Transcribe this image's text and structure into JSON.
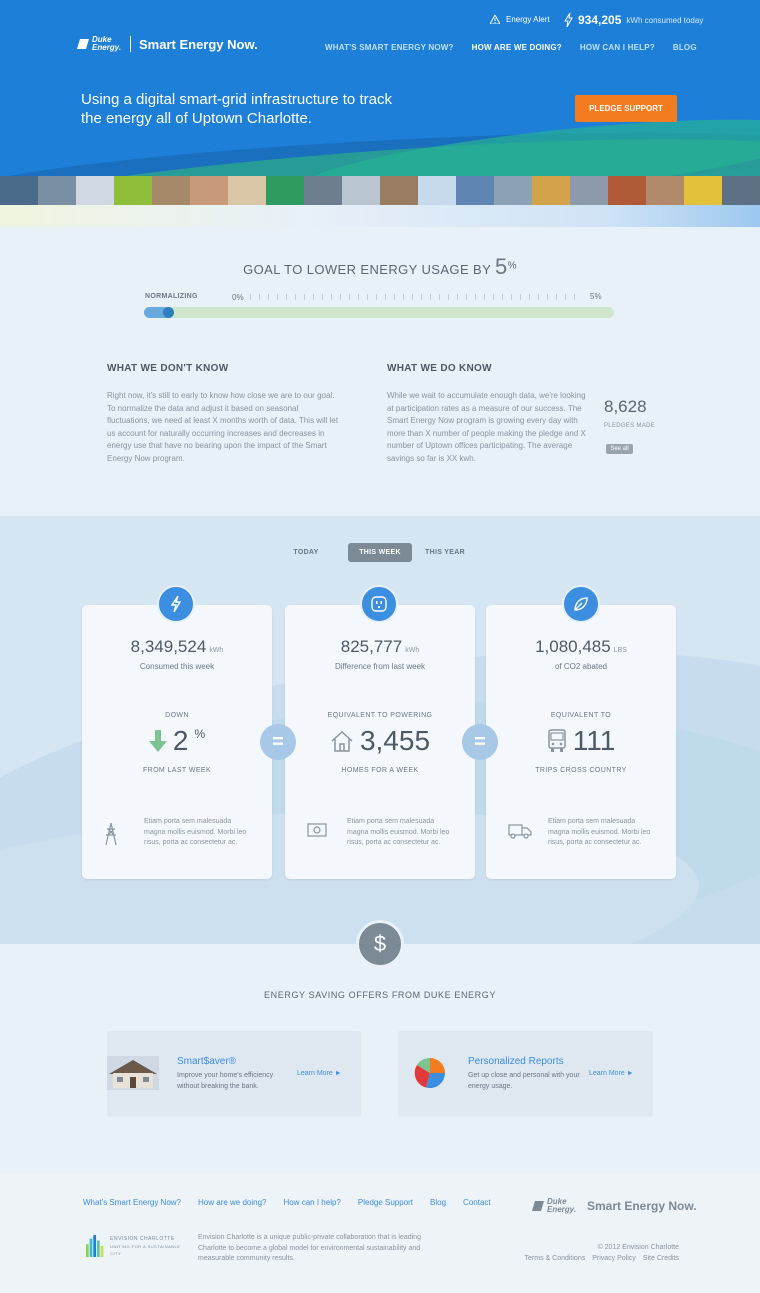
{
  "header": {
    "alert_label": "Energy Alert",
    "consumed_value": "934,205",
    "consumed_label": "kWh consumed today",
    "logo_duke": "Duke Energy.",
    "logo_product": "Smart Energy Now.",
    "nav": [
      {
        "label": "WHAT'S SMART ENERGY NOW?"
      },
      {
        "label": "HOW ARE WE DOING?",
        "active": true
      },
      {
        "label": "HOW CAN I HELP?"
      },
      {
        "label": "BLOG"
      }
    ],
    "tagline": "Using a digital smart-grid infrastructure to track the energy all of Uptown Charlotte.",
    "pledge_button": "PLEDGE SUPPORT",
    "brand_color": "#1d7fd8",
    "accent_color": "#f47b20"
  },
  "goal": {
    "title": "GOAL TO LOWER ENERGY USAGE BY",
    "value": "5",
    "unit": "%",
    "normalizing_label": "NORMALIZING",
    "start_label": "0%",
    "end_label": "5%",
    "progress_fraction": 0.06
  },
  "dont_know": {
    "heading": "WHAT WE DON'T KNOW",
    "body": "Right now, it's still to early to know how close we are to our goal. To normalize the data and adjust it based on seasonal fluctuations, we need at least X months worth of data. This will let us account for naturally occurring increases and decreases in energy use that have no bearing upon the impact of the Smart Energy Now program."
  },
  "do_know": {
    "heading": "WHAT WE DO KNOW",
    "body": "While we wait to accumulate enough data, we're looking at participation rates as a measure of our success. The Smart Energy Now program is growing every day with more than X number of people making the pledge and X number of Uptown offices participating. The average savings so far is XX kwh.",
    "pledges_value": "8,628",
    "pledges_label": "PLEDGES MADE",
    "see_all": "See all"
  },
  "tabs": [
    {
      "label": "TODAY"
    },
    {
      "label": "THIS WEEK",
      "active": true
    },
    {
      "label": "THIS YEAR"
    }
  ],
  "cards": [
    {
      "icon": "lightning-icon",
      "value": "8,349,524",
      "unit": "kWh",
      "label": "Consumed this week",
      "eq_top": "DOWN",
      "eq_value": "2",
      "eq_unit": "%",
      "eq_bottom": "FROM LAST WEEK",
      "foot_icon": "power-tower-icon",
      "foot_text": "Etiam porta sem malesuada magna mollis euismod. Morbi leo risus, porta ac consectetur ac."
    },
    {
      "icon": "outlet-icon",
      "value": "825,777",
      "unit": "kWh",
      "label": "Difference from last week",
      "eq_top": "EQUIVALENT TO POWERING",
      "eq_value": "3,455",
      "eq_unit": "",
      "eq_bottom": "HOMES FOR A WEEK",
      "foot_icon": "money-bill-icon",
      "foot_text": "Etiam porta sem malesuada magna mollis euismod. Morbi leo risus, porta ac consectetur ac."
    },
    {
      "icon": "leaf-icon",
      "value": "1,080,485",
      "unit": "LBS",
      "label": "of CO2 abated",
      "eq_top": "EQUIVALENT TO",
      "eq_value": "111",
      "eq_unit": "",
      "eq_bottom": "TRIPS CROSS COUNTRY",
      "foot_icon": "truck-icon",
      "foot_text": "Etiam porta sem malesuada magna mollis euismod. Morbi leo risus, porta ac consectetur ac."
    }
  ],
  "offers": {
    "title": "ENERGY SAVING OFFERS FROM DUKE ENERGY",
    "items": [
      {
        "title": "Smart$aver®",
        "desc": "Improve your home's efficiency without breaking the bank.",
        "link": "Learn More ►"
      },
      {
        "title": "Personalized Reports",
        "desc": "Get up close and personal with your energy usage.",
        "link": "Learn More ►"
      }
    ]
  },
  "footer": {
    "links": [
      {
        "label": "What's Smart Energy Now?"
      },
      {
        "label": "How are we doing?"
      },
      {
        "label": "How can I help?"
      },
      {
        "label": "Pledge Support"
      },
      {
        "label": "Blog"
      },
      {
        "label": "Contact"
      }
    ],
    "logo_duke": "Duke Energy.",
    "logo_product": "Smart Energy Now.",
    "envision_name": "ENVISION CHARLOTTE",
    "envision_sub": "UNITING FOR A SUSTAINABLE CITY",
    "description": "Envision Charlotte is a unique public-private collaboration that is leading Charlotte to become a global model for environmental sustainability and measurable community results.",
    "copyright": "© 2012 Envision Charlotte",
    "legal": [
      {
        "label": "Terms & Conditions"
      },
      {
        "label": "Privacy Policy"
      },
      {
        "label": "Site Credits"
      }
    ]
  }
}
